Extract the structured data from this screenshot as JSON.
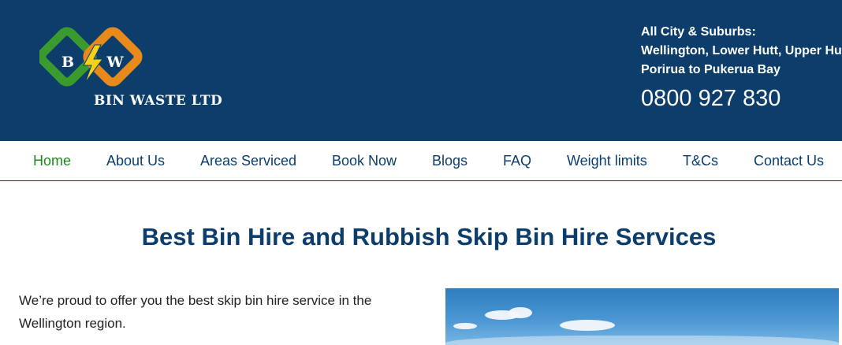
{
  "header": {
    "logo": {
      "monogram_left": "B",
      "monogram_right": "W",
      "company_name": "BIN WASTE LTD",
      "colors": {
        "green": "#3a9a2d",
        "orange": "#e8891c",
        "bolt": "#f3d21b"
      }
    },
    "service_area": {
      "line1": "All City & Suburbs:",
      "line2": "Wellington, Lower Hutt, Upper Hutt,",
      "line3": "Porirua to Pukerua Bay"
    },
    "phone": "0800 927 830",
    "background_color": "#0c3d6b"
  },
  "nav": {
    "items": [
      {
        "label": "Home",
        "active": true
      },
      {
        "label": "About Us"
      },
      {
        "label": "Areas Serviced"
      },
      {
        "label": "Book Now"
      },
      {
        "label": "Blogs"
      },
      {
        "label": "FAQ"
      },
      {
        "label": "Weight limits"
      },
      {
        "label": "T&Cs"
      },
      {
        "label": "Contact Us"
      }
    ],
    "active_color": "#1d8a1d",
    "text_color": "#0c3d6b"
  },
  "main": {
    "title": "Best Bin Hire and Rubbish Skip Bin Hire Services",
    "intro": "We’re proud to offer you the best skip bin hire service in the Wellington region.",
    "hero_image": "sky-with-clouds"
  }
}
